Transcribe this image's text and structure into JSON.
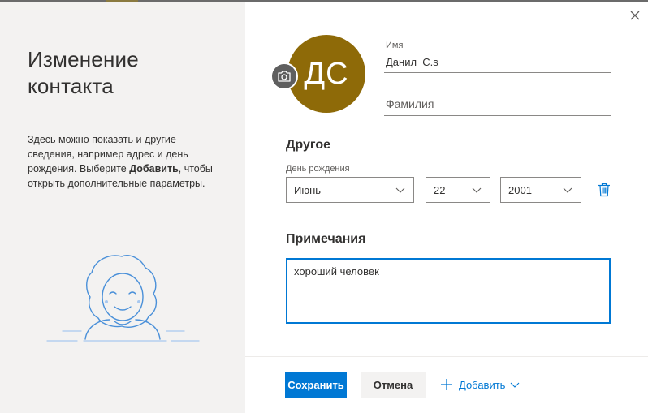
{
  "panel": {
    "title_line1": "Изменение",
    "title_line2": "контакта",
    "desc_before": "Здесь можно показать и другие сведения, например адрес и день рождения. Выберите ",
    "desc_bold": "Добавить",
    "desc_after": ", чтобы открыть дополнительные параметры."
  },
  "avatar": {
    "initials": "ДС",
    "color": "#8e6a08",
    "camera_icon": "camera-icon"
  },
  "name": {
    "first_label": "Имя",
    "first_value": "Данил  C.s",
    "last_placeholder": "Фамилия"
  },
  "other": {
    "title": "Другое",
    "birthday_label": "День рождения",
    "month": "Июнь",
    "day": "22",
    "year": "2001",
    "delete_icon": "trash-icon"
  },
  "notes": {
    "title": "Примечания",
    "value": "хороший человек"
  },
  "footer": {
    "save_label": "Сохранить",
    "cancel_label": "Отмена",
    "add_label": "Добавить"
  },
  "colors": {
    "accent": "#0078d4",
    "left_panel_bg": "#f3f2f1"
  }
}
